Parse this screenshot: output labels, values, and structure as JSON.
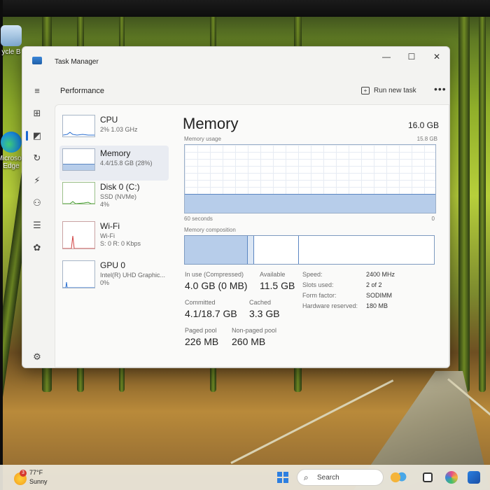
{
  "desktop": {
    "icons": [
      {
        "label": "ycle B"
      },
      {
        "label": "Microsoft Edge"
      }
    ]
  },
  "window": {
    "title": "Task Manager",
    "minimize_glyph": "—",
    "maximize_glyph": "☐",
    "close_glyph": "✕"
  },
  "header": {
    "title": "Performance",
    "run_new_task": "Run new task",
    "more": "•••"
  },
  "rail": {
    "items": [
      {
        "icon": "hamburger-icon",
        "glyph": "≡"
      },
      {
        "icon": "processes-icon",
        "glyph": "⊞"
      },
      {
        "icon": "performance-icon",
        "glyph": "◩"
      },
      {
        "icon": "app-history-icon",
        "glyph": "↻"
      },
      {
        "icon": "startup-apps-icon",
        "glyph": "⚡"
      },
      {
        "icon": "users-icon",
        "glyph": "⚇"
      },
      {
        "icon": "details-icon",
        "glyph": "☰"
      },
      {
        "icon": "services-icon",
        "glyph": "✿"
      }
    ],
    "settings_glyph": "⚙"
  },
  "resources": [
    {
      "name": "CPU",
      "line1": "2% 1.03 GHz",
      "line2": ""
    },
    {
      "name": "Memory",
      "line1": "4.4/15.8 GB (28%)",
      "line2": ""
    },
    {
      "name": "Disk 0 (C:)",
      "line1": "SSD (NVMe)",
      "line2": "4%"
    },
    {
      "name": "Wi-Fi",
      "line1": "Wi-Fi",
      "line2": "S: 0 R: 0 Kbps"
    },
    {
      "name": "GPU 0",
      "line1": "Intel(R) UHD Graphic...",
      "line2": "0%"
    }
  ],
  "memory": {
    "title": "Memory",
    "total": "16.0 GB",
    "usage_label": "Memory usage",
    "usage_max": "15.8 GB",
    "time_left": "60 seconds",
    "time_right": "0",
    "composition_label": "Memory composition",
    "usage_fraction": 0.28,
    "stats": {
      "in_use_label": "In use (Compressed)",
      "in_use_value": "4.0 GB (0 MB)",
      "available_label": "Available",
      "available_value": "11.5 GB",
      "committed_label": "Committed",
      "committed_value": "4.1/18.7 GB",
      "cached_label": "Cached",
      "cached_value": "3.3 GB",
      "paged_label": "Paged pool",
      "paged_value": "226 MB",
      "nonpaged_label": "Non-paged pool",
      "nonpaged_value": "260 MB"
    },
    "specs": {
      "speed_label": "Speed:",
      "speed_value": "2400 MHz",
      "slots_label": "Slots used:",
      "slots_value": "2 of 2",
      "form_label": "Form factor:",
      "form_value": "SODIMM",
      "reserved_label": "Hardware reserved:",
      "reserved_value": "180 MB"
    }
  },
  "taskbar": {
    "badge": "3",
    "temperature": "77°F",
    "condition": "Sunny",
    "search_label": "Search"
  },
  "colors": {
    "accent": "#1967d2",
    "memory_fill": "#b7cdea",
    "memory_line": "#5b86c2"
  }
}
